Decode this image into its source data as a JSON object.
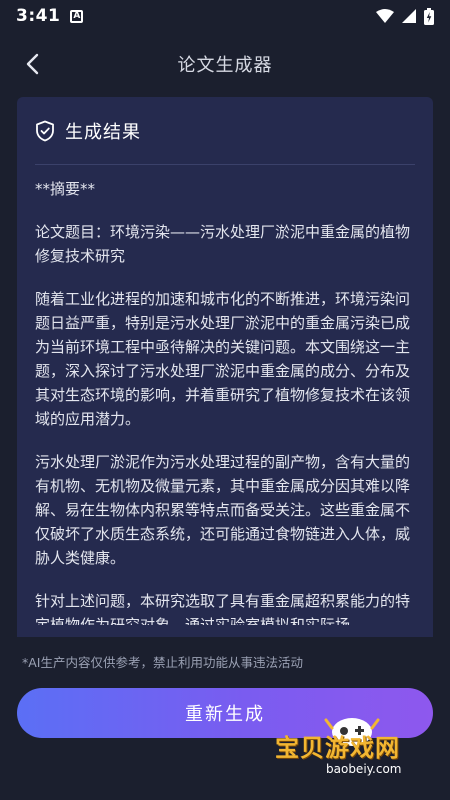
{
  "status_bar": {
    "time": "3:41",
    "notification_letter": "A"
  },
  "header": {
    "title": "论文生成器"
  },
  "result_card": {
    "title": "生成结果",
    "paragraphs": [
      "**摘要**",
      "论文题目：环境污染——污水处理厂淤泥中重金属的植物修复技术研究",
      "随着工业化进程的加速和城市化的不断推进，环境污染问题日益严重，特别是污水处理厂淤泥中的重金属污染已成为当前环境工程中亟待解决的关键问题。本文围绕这一主题，深入探讨了污水处理厂淤泥中重金属的成分、分布及其对生态环境的影响，并着重研究了植物修复技术在该领域的应用潜力。",
      "污水处理厂淤泥作为污水处理过程的副产物，含有大量的有机物、无机物及微量元素，其中重金属成分因其难以降解、易在生物体内积累等特点而备受关注。这些重金属不仅破坏了水质生态系统，还可能通过食物链进入人体，威胁人类健康。",
      "针对上述问题，本研究选取了具有重金属超积累能力的特定植物作为研究对象，通过实验室模拟和实际场"
    ]
  },
  "disclaimer": "*AI生产内容仅供参考，禁止利用功能从事违法活动",
  "actions": {
    "regenerate_label": "重新生成"
  },
  "watermark": {
    "text": "宝贝游戏网",
    "url": "baobeiy.com"
  },
  "colors": {
    "background": "#1b1f2e",
    "card": "#252a4e",
    "button_start": "#5b6ff5",
    "button_end": "#8e58ee"
  }
}
